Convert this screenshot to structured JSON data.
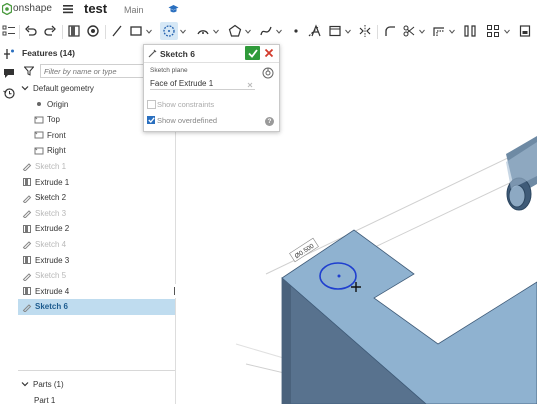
{
  "app": {
    "logo_text": "onshape",
    "doc_title": "test",
    "workspace": "Main"
  },
  "toolbar": {
    "icons": [
      "undo-icon",
      "redo-icon",
      "new-sketch-icon",
      "extrude-icon",
      "line-icon",
      "rectangle-icon",
      "circle-icon",
      "arc-icon",
      "polygon-icon",
      "spline-icon",
      "point-icon",
      "text-icon",
      "offset-icon",
      "mirror-icon",
      "fillet-icon",
      "trim-icon",
      "extend-icon",
      "pattern-icon",
      "transform-icon",
      "use-icon"
    ]
  },
  "features": {
    "header": "Features (14)",
    "filter_placeholder": "Filter by name or type",
    "default_geometry": "Default geometry",
    "items": [
      {
        "label": "Origin",
        "kind": "origin",
        "indent": 2,
        "state": "normal"
      },
      {
        "label": "Top",
        "kind": "plane",
        "indent": 2,
        "state": "normal"
      },
      {
        "label": "Front",
        "kind": "plane",
        "indent": 2,
        "state": "normal"
      },
      {
        "label": "Right",
        "kind": "plane",
        "indent": 2,
        "state": "normal"
      },
      {
        "label": "Sketch 1",
        "kind": "sketch",
        "indent": 1,
        "state": "dim"
      },
      {
        "label": "Extrude 1",
        "kind": "extrude",
        "indent": 1,
        "state": "normal"
      },
      {
        "label": "Sketch 2",
        "kind": "sketch",
        "indent": 1,
        "state": "normal"
      },
      {
        "label": "Sketch 3",
        "kind": "sketch",
        "indent": 1,
        "state": "dim"
      },
      {
        "label": "Extrude 2",
        "kind": "extrude",
        "indent": 1,
        "state": "normal"
      },
      {
        "label": "Sketch 4",
        "kind": "sketch",
        "indent": 1,
        "state": "dim"
      },
      {
        "label": "Extrude 3",
        "kind": "extrude",
        "indent": 1,
        "state": "normal"
      },
      {
        "label": "Sketch 5",
        "kind": "sketch",
        "indent": 1,
        "state": "dim"
      },
      {
        "label": "Extrude 4",
        "kind": "extrude",
        "indent": 1,
        "state": "normal"
      },
      {
        "label": "Sketch 6",
        "kind": "sketch",
        "indent": 1,
        "state": "selected"
      }
    ],
    "parts_header": "Parts (1)",
    "parts": [
      "Part 1"
    ]
  },
  "dialog": {
    "title": "Sketch 6",
    "plane_label": "Sketch plane",
    "plane_value": "Face of Extrude 1",
    "show_constraints_label": "Show constraints",
    "show_constraints_checked": false,
    "show_overdefined_label": "Show overdefined",
    "show_overdefined_checked": true,
    "accept_color": "#2f9a3a",
    "cancel_color": "#d33a2c"
  },
  "viewport": {
    "dimension_label": "Ø0.500",
    "part_color": "#8fb2d0",
    "sketch_color": "#1f3fcf"
  }
}
